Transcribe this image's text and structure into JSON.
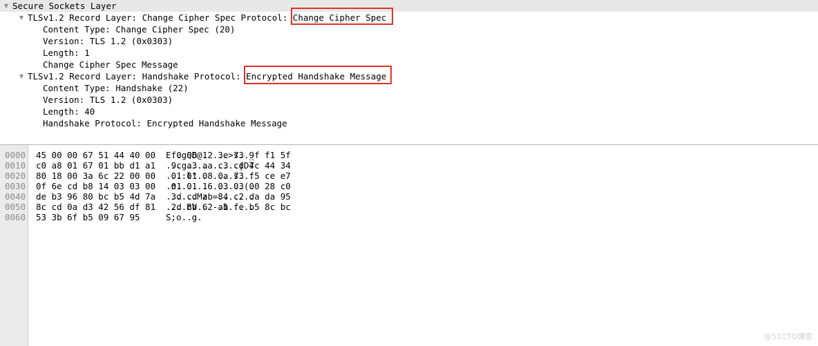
{
  "detail_tree": {
    "rows": [
      {
        "level": 0,
        "twisty": "▼",
        "text": "Secure Sockets Layer",
        "selected": true
      },
      {
        "level": 1,
        "twisty": "▼",
        "text": "TLSv1.2 Record Layer: Change Cipher Spec Protocol: Change Cipher Spec",
        "selected": false
      },
      {
        "level": 2,
        "twisty": "",
        "text": "Content Type: Change Cipher Spec (20)",
        "selected": false
      },
      {
        "level": 2,
        "twisty": "",
        "text": "Version: TLS 1.2 (0x0303)",
        "selected": false
      },
      {
        "level": 2,
        "twisty": "",
        "text": "Length: 1",
        "selected": false
      },
      {
        "level": 2,
        "twisty": "",
        "text": "Change Cipher Spec Message",
        "selected": false
      },
      {
        "level": 1,
        "twisty": "▼",
        "text": "TLSv1.2 Record Layer: Handshake Protocol: Encrypted Handshake Message",
        "selected": false
      },
      {
        "level": 2,
        "twisty": "",
        "text": "Content Type: Handshake (22)",
        "selected": false
      },
      {
        "level": 2,
        "twisty": "",
        "text": "Version: TLS 1.2 (0x0303)",
        "selected": false
      },
      {
        "level": 2,
        "twisty": "",
        "text": "Length: 40",
        "selected": false
      },
      {
        "level": 2,
        "twisty": "",
        "text": "Handshake Protocol: Encrypted Handshake Message",
        "selected": false
      }
    ]
  },
  "annotations": {
    "color": "#e03127",
    "boxes": [
      {
        "id": "redbox-ccs",
        "label": "Change Cipher Spec"
      },
      {
        "id": "redbox-ehm",
        "label": "Encrypted Handshake Message"
      }
    ]
  },
  "hex_dump": {
    "rows": [
      {
        "offset": "0000",
        "bytes": "45 00 00 67 51 44 40 00   f0 06 12 3e 73 9f f1 5f",
        "ascii": "E..gQD@. ...>s.._"
      },
      {
        "offset": "0010",
        "bytes": "c0 a8 01 67 01 bb d1 a1   9c a3 aa c3 cd 7c 44 34",
        "ascii": "...g.... .....|D4"
      },
      {
        "offset": "0020",
        "bytes": "80 18 00 3a 6c 22 00 00   01 01 08 0a 73 f5 ce e7",
        "ascii": "...:l\".. ....s..."
      },
      {
        "offset": "0030",
        "bytes": "0f 6e cd b8 14 03 03 00   01 01 16 03 03 00 28 c0",
        "ascii": ".n...... ......(."
      },
      {
        "offset": "0040",
        "bytes": "de b3 96 80 bc b5 4d 7a   3d cd ab 84 c2 da da 95",
        "ascii": "......Mz =......."
      },
      {
        "offset": "0050",
        "bytes": "8c cd 0a d3 42 56 df 81   2d cb 62 a1 fe b5 8c bc",
        "ascii": "....BV.. -.b....."
      },
      {
        "offset": "0060",
        "bytes": "53 3b 6f b5 09 67 95",
        "ascii": "S;o..g."
      }
    ]
  },
  "watermark": {
    "text": "@51CTO博客"
  }
}
